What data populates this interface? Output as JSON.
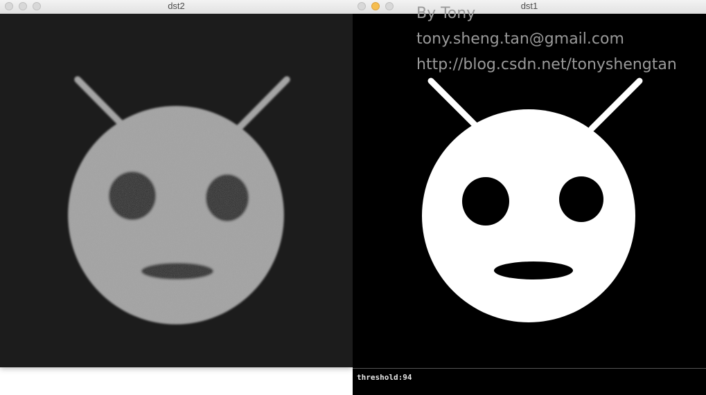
{
  "windows": {
    "left": {
      "title": "dst2"
    },
    "right": {
      "title": "dst1"
    }
  },
  "overlay": {
    "line1": "By Tony",
    "line2": "tony.sheng.tan@gmail.com",
    "line3": "http://blog.csdn.net/tonyshengtan"
  },
  "status": {
    "threshold_text": "threshold:94"
  },
  "colors": {
    "grayscale_face": "#a2a2a2",
    "grayscale_bg": "#1c1c1c",
    "binary_face": "#ffffff",
    "binary_bg": "#000000",
    "traffic_yellow": "#f6be4f"
  }
}
